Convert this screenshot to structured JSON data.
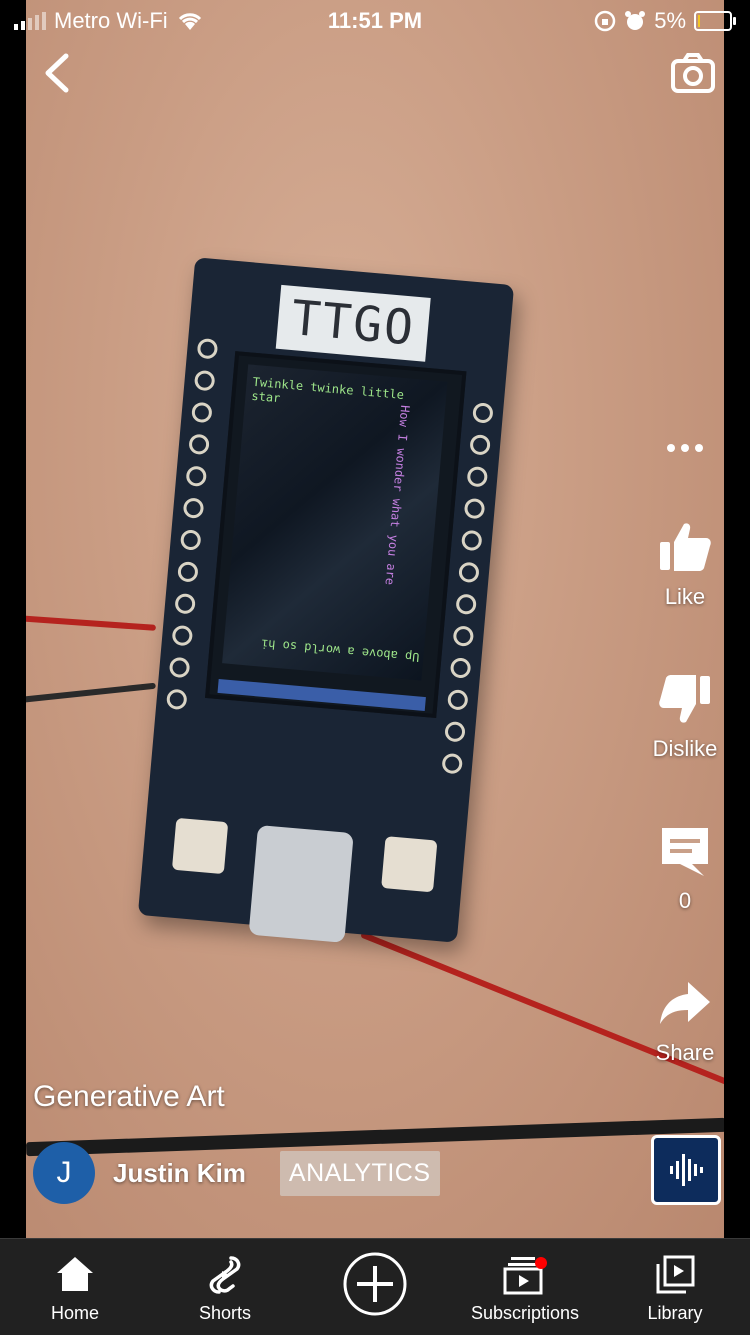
{
  "status_bar": {
    "carrier": "Metro Wi-Fi",
    "time": "11:51 PM",
    "battery": "5%",
    "battery_level": 0.05
  },
  "video": {
    "board_label": "TTGO",
    "screen_text_top": "Twinkle twinke little star",
    "screen_text_side": "How I wonder what you are",
    "screen_text_bottom": "Up above a world so hi"
  },
  "actions": {
    "like_label": "Like",
    "dislike_label": "Dislike",
    "comments_count": "0",
    "share_label": "Share"
  },
  "video_info": {
    "title": "Generative Art",
    "avatar_letter": "J",
    "channel_name": "Justin Kim",
    "analytics_label": "ANALYTICS"
  },
  "nav": {
    "items": [
      {
        "label": "Home",
        "icon": "home-icon"
      },
      {
        "label": "Shorts",
        "icon": "shorts-icon"
      },
      {
        "label": "",
        "icon": "create-icon"
      },
      {
        "label": "Subscriptions",
        "icon": "subscriptions-icon"
      },
      {
        "label": "Library",
        "icon": "library-icon"
      }
    ]
  },
  "colors": {
    "nav_bg": "#212121",
    "avatar_bg": "#1e5fa8",
    "notification_dot": "#ff0000",
    "lcd_text_green": "#9ee68a",
    "lcd_text_purple": "#c47fe0"
  }
}
